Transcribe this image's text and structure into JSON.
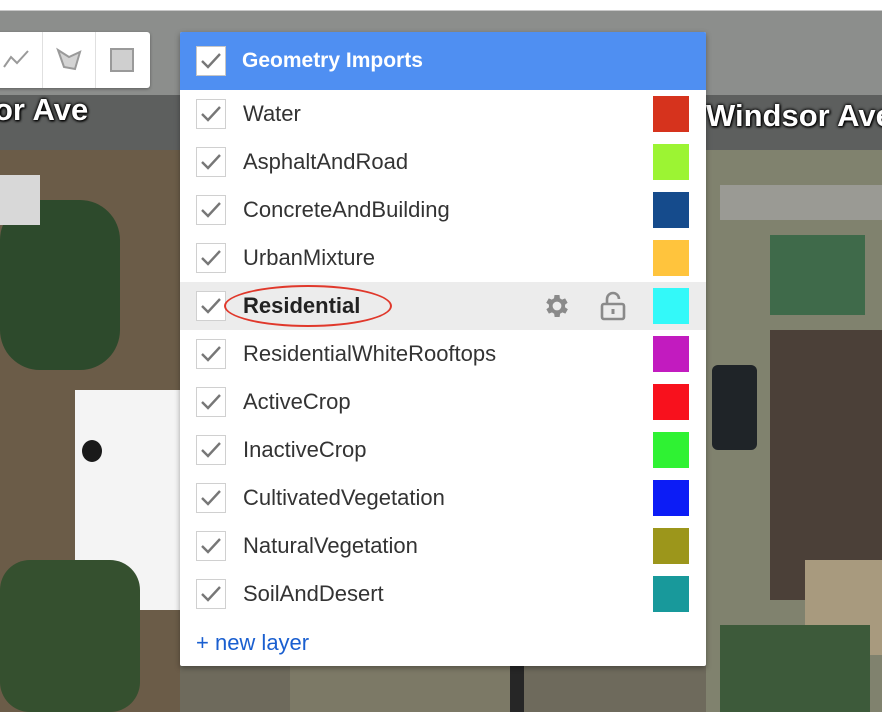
{
  "map": {
    "street_labels": [
      "or Ave",
      "Windsor Ave"
    ]
  },
  "draw_toolbar": {
    "tools": [
      {
        "name": "line-tool",
        "icon": "polyline-icon"
      },
      {
        "name": "polygon-tool",
        "icon": "polygon-icon"
      },
      {
        "name": "rectangle-tool",
        "icon": "rectangle-icon"
      }
    ]
  },
  "panel": {
    "title": "Geometry Imports",
    "new_layer_label": "+ new layer",
    "layers": [
      {
        "name": "Water",
        "color": "#d6331d"
      },
      {
        "name": "AsphaltAndRoad",
        "color": "#9cf433"
      },
      {
        "name": "ConcreteAndBuilding",
        "color": "#154b8c"
      },
      {
        "name": "UrbanMixture",
        "color": "#ffc43d"
      },
      {
        "name": "Residential",
        "color": "#33f9f9"
      },
      {
        "name": "ResidentialWhiteRooftops",
        "color": "#c21bbf"
      },
      {
        "name": "ActiveCrop",
        "color": "#f8111d"
      },
      {
        "name": "InactiveCrop",
        "color": "#2ff233"
      },
      {
        "name": "CultivatedVegetation",
        "color": "#0c1cf6"
      },
      {
        "name": "NaturalVegetation",
        "color": "#9c961b"
      },
      {
        "name": "SoilAndDesert",
        "color": "#18999b"
      }
    ],
    "active_layer": "Residential"
  }
}
